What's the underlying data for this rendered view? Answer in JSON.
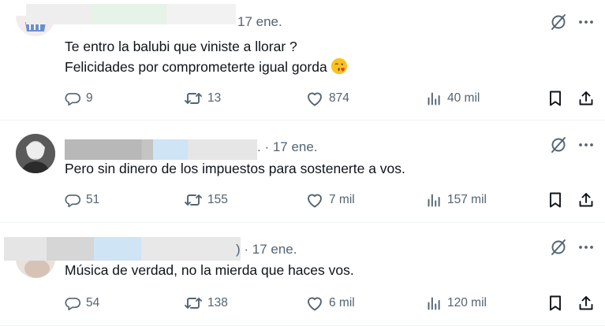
{
  "tweets": [
    {
      "date": "17 ene.",
      "lines": [
        "Te entro la balubi que viniste a llorar ?",
        "Felicidades por comprometerte igual gorda"
      ],
      "emoji": "face-blowing-kiss-emoji",
      "replies": "9",
      "retweets": "13",
      "likes": "874",
      "views": "40 mil"
    },
    {
      "date": ". · 17 ene.",
      "lines": [
        "Pero sin dinero de los impuestos para sostenerte a vos."
      ],
      "replies": "51",
      "retweets": "155",
      "likes": "7 mil",
      "views": "157 mil"
    },
    {
      "date": ") · 17 ene.",
      "lines": [
        "Música de verdad, no la mierda que haces vos."
      ],
      "replies": "54",
      "retweets": "138",
      "likes": "6 mil",
      "views": "120 mil"
    }
  ],
  "icons": {
    "reply": "reply-icon",
    "retweet": "retweet-icon",
    "like": "heart-icon",
    "views": "views-icon",
    "bookmark": "bookmark-icon",
    "share": "share-icon",
    "grok": "grok-icon",
    "more": "more-icon"
  },
  "colors": {
    "text": "#0f1419",
    "muted": "#536471",
    "divider": "#eff3f4"
  }
}
